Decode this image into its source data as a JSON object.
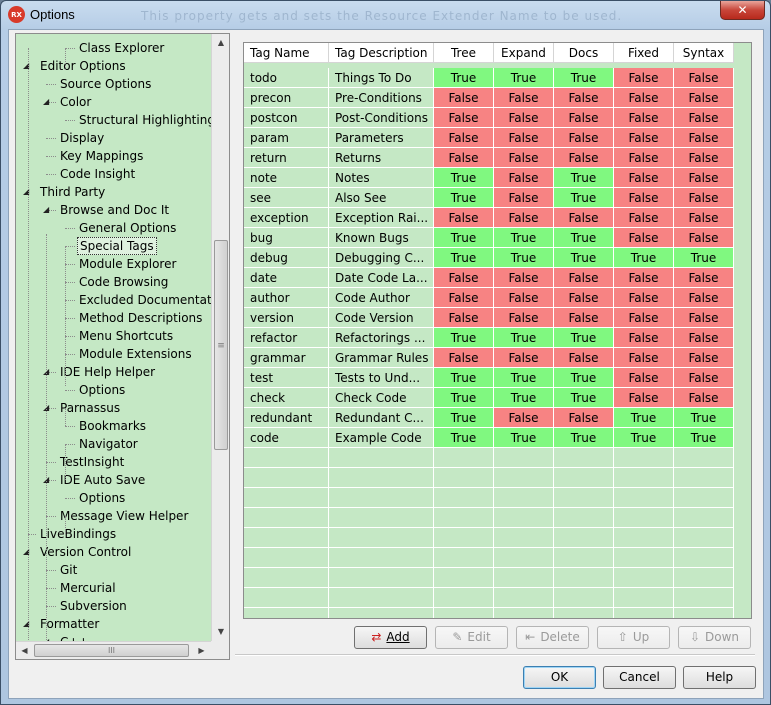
{
  "window": {
    "title": "Options",
    "app_icon_text": "RX",
    "ghost_hint": "This property gets and sets the Resource Extender Name to be used.",
    "close_glyph": "✕"
  },
  "tree": {
    "items": [
      {
        "label": "Class Explorer",
        "level": 2,
        "expander": ""
      },
      {
        "label": "Editor Options",
        "level": 0,
        "expander": "down"
      },
      {
        "label": "Source Options",
        "level": 1,
        "expander": ""
      },
      {
        "label": "Color",
        "level": 1,
        "expander": "down"
      },
      {
        "label": "Structural Highlighting",
        "level": 2,
        "expander": ""
      },
      {
        "label": "Display",
        "level": 1,
        "expander": ""
      },
      {
        "label": "Key Mappings",
        "level": 1,
        "expander": ""
      },
      {
        "label": "Code Insight",
        "level": 1,
        "expander": ""
      },
      {
        "label": "Third Party",
        "level": 0,
        "expander": "down"
      },
      {
        "label": "Browse and Doc It",
        "level": 1,
        "expander": "down"
      },
      {
        "label": "General Options",
        "level": 2,
        "expander": ""
      },
      {
        "label": "Special Tags",
        "level": 2,
        "expander": "",
        "selected": true
      },
      {
        "label": "Module Explorer",
        "level": 2,
        "expander": ""
      },
      {
        "label": "Code Browsing",
        "level": 2,
        "expander": ""
      },
      {
        "label": "Excluded Documentatio",
        "level": 2,
        "expander": ""
      },
      {
        "label": "Method Descriptions",
        "level": 2,
        "expander": ""
      },
      {
        "label": "Menu Shortcuts",
        "level": 2,
        "expander": ""
      },
      {
        "label": "Module Extensions",
        "level": 2,
        "expander": ""
      },
      {
        "label": "IDE Help Helper",
        "level": 1,
        "expander": "down"
      },
      {
        "label": "Options",
        "level": 2,
        "expander": ""
      },
      {
        "label": "Parnassus",
        "level": 1,
        "expander": "down"
      },
      {
        "label": "Bookmarks",
        "level": 2,
        "expander": ""
      },
      {
        "label": "Navigator",
        "level": 2,
        "expander": ""
      },
      {
        "label": "TestInsight",
        "level": 1,
        "expander": ""
      },
      {
        "label": "IDE Auto Save",
        "level": 1,
        "expander": "down"
      },
      {
        "label": "Options",
        "level": 2,
        "expander": ""
      },
      {
        "label": "Message View Helper",
        "level": 1,
        "expander": ""
      },
      {
        "label": "LiveBindings",
        "level": 0,
        "expander": ""
      },
      {
        "label": "Version Control",
        "level": 0,
        "expander": "down"
      },
      {
        "label": "Git",
        "level": 1,
        "expander": ""
      },
      {
        "label": "Mercurial",
        "level": 1,
        "expander": ""
      },
      {
        "label": "Subversion",
        "level": 1,
        "expander": ""
      },
      {
        "label": "Formatter",
        "level": 0,
        "expander": "down"
      },
      {
        "label": "C++",
        "level": 1,
        "expander": "down"
      }
    ],
    "scroll_up": "▲",
    "scroll_down": "▼",
    "scroll_left": "◀",
    "scroll_right": "▶",
    "grip_v": "≡",
    "grip_h": "III"
  },
  "grid": {
    "columns": [
      "Tag Name",
      "Tag Description",
      "Tree",
      "Expand",
      "Docs",
      "Fixed",
      "Syntax"
    ],
    "rows": [
      {
        "name": "todo",
        "desc": "Things To Do",
        "flags": [
          "True",
          "True",
          "True",
          "False",
          "False"
        ]
      },
      {
        "name": "precon",
        "desc": "Pre-Conditions",
        "flags": [
          "False",
          "False",
          "False",
          "False",
          "False"
        ]
      },
      {
        "name": "postcon",
        "desc": "Post-Conditions",
        "flags": [
          "False",
          "False",
          "False",
          "False",
          "False"
        ]
      },
      {
        "name": "param",
        "desc": "Parameters",
        "flags": [
          "False",
          "False",
          "False",
          "False",
          "False"
        ]
      },
      {
        "name": "return",
        "desc": "Returns",
        "flags": [
          "False",
          "False",
          "False",
          "False",
          "False"
        ]
      },
      {
        "name": "note",
        "desc": "Notes",
        "flags": [
          "True",
          "False",
          "True",
          "False",
          "False"
        ]
      },
      {
        "name": "see",
        "desc": "Also See",
        "flags": [
          "True",
          "False",
          "True",
          "False",
          "False"
        ]
      },
      {
        "name": "exception",
        "desc": "Exception Rai...",
        "flags": [
          "False",
          "False",
          "False",
          "False",
          "False"
        ]
      },
      {
        "name": "bug",
        "desc": "Known Bugs",
        "flags": [
          "True",
          "True",
          "True",
          "False",
          "False"
        ]
      },
      {
        "name": "debug",
        "desc": "Debugging C...",
        "flags": [
          "True",
          "True",
          "True",
          "True",
          "True"
        ]
      },
      {
        "name": "date",
        "desc": "Date Code La...",
        "flags": [
          "False",
          "False",
          "False",
          "False",
          "False"
        ]
      },
      {
        "name": "author",
        "desc": "Code Author",
        "flags": [
          "False",
          "False",
          "False",
          "False",
          "False"
        ]
      },
      {
        "name": "version",
        "desc": "Code Version",
        "flags": [
          "False",
          "False",
          "False",
          "False",
          "False"
        ]
      },
      {
        "name": "refactor",
        "desc": "Refactorings ...",
        "flags": [
          "True",
          "True",
          "True",
          "False",
          "False"
        ]
      },
      {
        "name": "grammar",
        "desc": "Grammar Rules",
        "flags": [
          "False",
          "False",
          "False",
          "False",
          "False"
        ]
      },
      {
        "name": "test",
        "desc": "Tests to Und...",
        "flags": [
          "True",
          "True",
          "True",
          "False",
          "False"
        ]
      },
      {
        "name": "check",
        "desc": "Check Code",
        "flags": [
          "True",
          "True",
          "True",
          "False",
          "False"
        ]
      },
      {
        "name": "redundant",
        "desc": "Redundant C...",
        "flags": [
          "True",
          "False",
          "False",
          "True",
          "True"
        ]
      },
      {
        "name": "code",
        "desc": "Example Code",
        "flags": [
          "True",
          "True",
          "True",
          "True",
          "True"
        ]
      }
    ],
    "colors": {
      "true_bg": "#80f880",
      "false_bg": "#f78383",
      "grid_bg": "#c5e8c5"
    }
  },
  "actions": {
    "add": {
      "label": "Add",
      "icon": "add-icon",
      "glyph": "⇄",
      "enabled": true
    },
    "edit": {
      "label": "Edit",
      "icon": "edit-icon",
      "glyph": "✎",
      "enabled": false
    },
    "delete": {
      "label": "Delete",
      "icon": "delete-icon",
      "glyph": "⇤",
      "enabled": false
    },
    "up": {
      "label": "Up",
      "icon": "up-arrow-icon",
      "glyph": "⇧",
      "enabled": false
    },
    "down": {
      "label": "Down",
      "icon": "down-arrow-icon",
      "glyph": "⇩",
      "enabled": false
    }
  },
  "dialog": {
    "ok": "OK",
    "cancel": "Cancel",
    "help": "Help"
  }
}
